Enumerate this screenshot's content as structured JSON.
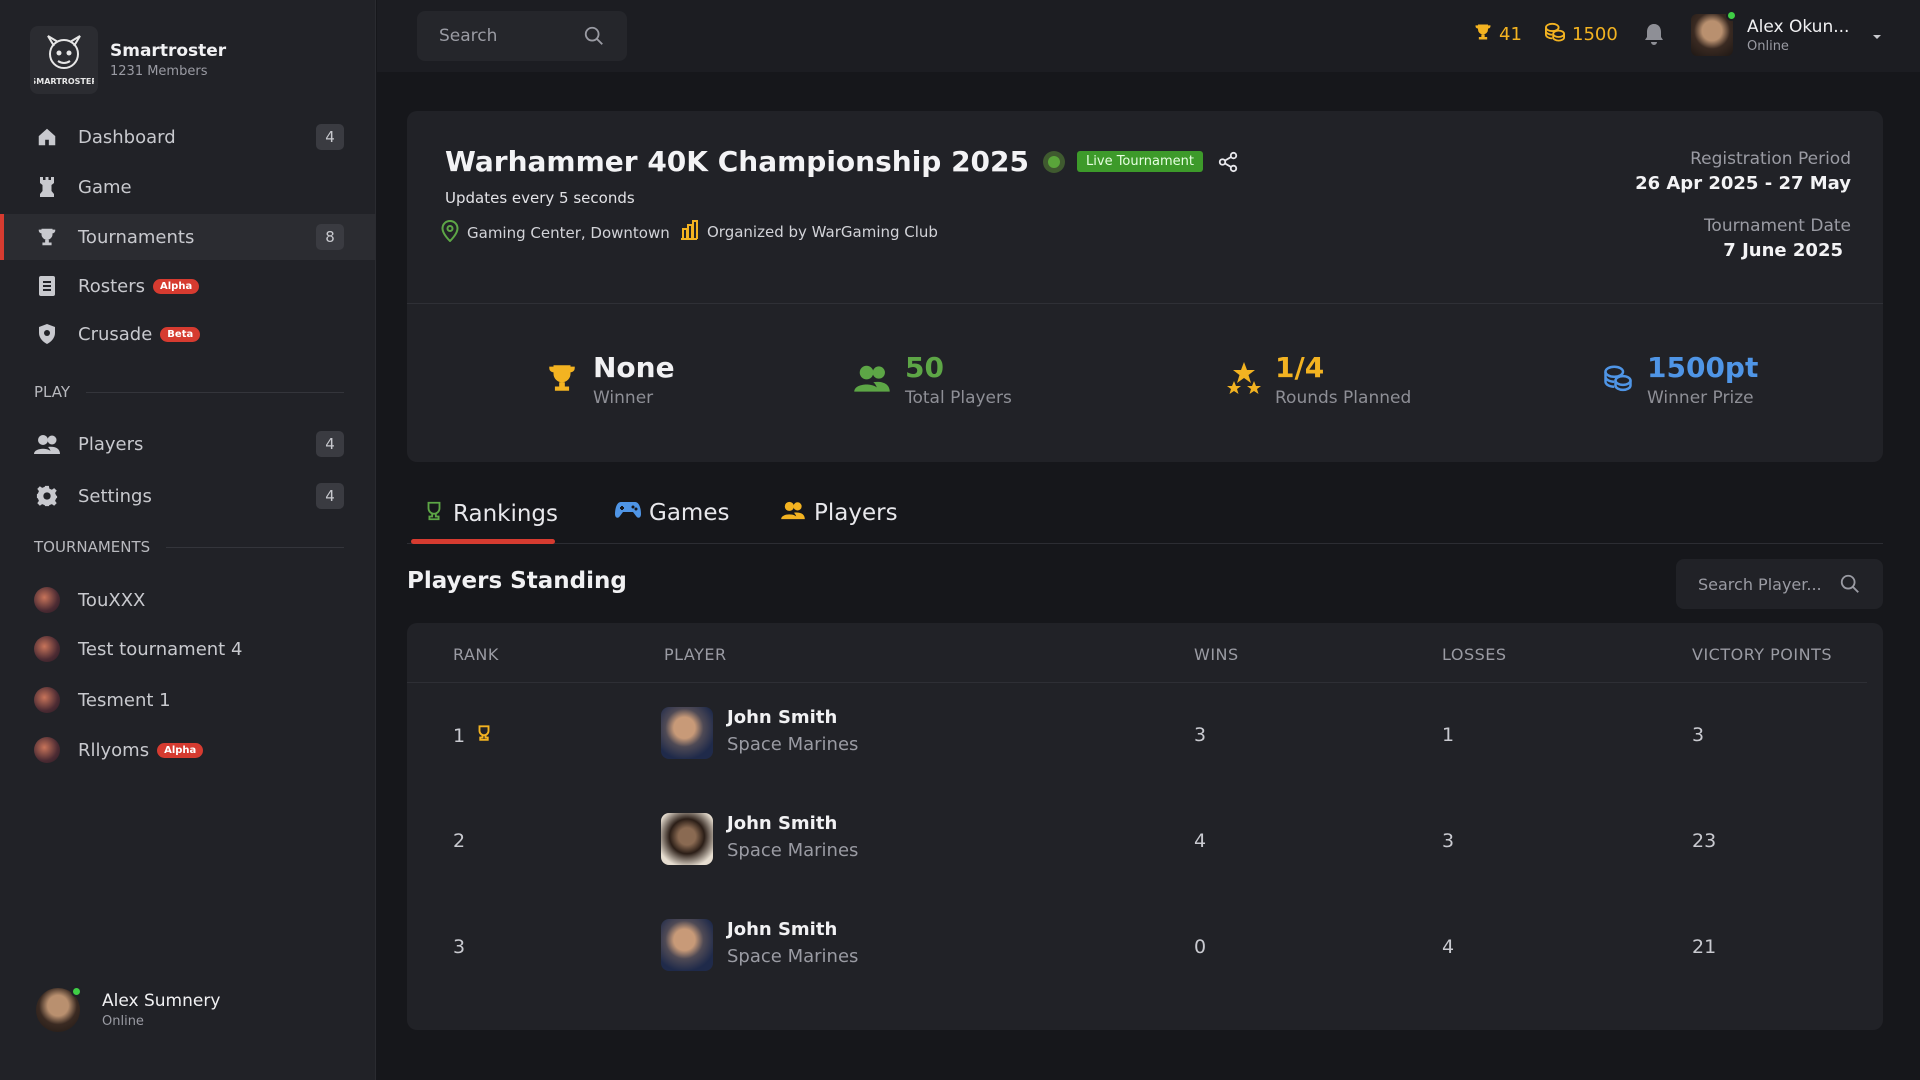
{
  "brand": {
    "name": "Smartroster",
    "members": "1231 Members",
    "logo_text": "SMARTROSTER"
  },
  "nav": {
    "items": [
      {
        "label": "Dashboard",
        "count": "4",
        "icon": "home-icon"
      },
      {
        "label": "Game",
        "icon": "chess-rook-icon"
      },
      {
        "label": "Tournaments",
        "count": "8",
        "icon": "trophy-icon"
      },
      {
        "label": "Rosters",
        "badge": "Alpha",
        "icon": "list-icon"
      },
      {
        "label": "Crusade",
        "badge": "Beta",
        "icon": "shield-icon"
      }
    ],
    "play_section": "PLAY",
    "play_items": [
      {
        "label": "Players",
        "count": "4",
        "icon": "users-icon"
      },
      {
        "label": "Settings",
        "count": "4",
        "icon": "gear-icon"
      }
    ],
    "tournaments_section": "TOURNAMENTS",
    "tournaments": [
      {
        "label": "TouXXX"
      },
      {
        "label": "Test tournament 4"
      },
      {
        "label": "Tesment 1"
      },
      {
        "label": "Rllyoms",
        "badge": "Alpha"
      }
    ]
  },
  "sidebar_user": {
    "name": "Alex Sumnery",
    "status": "Online"
  },
  "topbar": {
    "search_placeholder": "Search",
    "trophies": "41",
    "coins": "1500",
    "user_name": "Alex Okun...",
    "user_status": "Online"
  },
  "tournament": {
    "title": "Warhammer 40K Championship 2025",
    "live_label": "Live Tournament",
    "updates": "Updates every 5 seconds",
    "location": "Gaming Center, Downtown",
    "organizer": "Organized by WarGaming Club",
    "registration_label": "Registration Period",
    "registration_value": "26 Apr 2025 - 27 May",
    "date_label": "Tournament Date",
    "date_value": "7 June 2025",
    "stats": [
      {
        "value": "None",
        "label": "Winner",
        "color": "#f1f1f3"
      },
      {
        "value": "50",
        "label": "Total Players",
        "color": "#5da646"
      },
      {
        "value": "1/4",
        "label": "Rounds Planned",
        "color": "#f3b321"
      },
      {
        "value": "1500pt",
        "label": "Winner Prize",
        "color": "#4f95e6"
      }
    ]
  },
  "tabs": [
    {
      "label": "Rankings",
      "icon": "trophy-icon"
    },
    {
      "label": "Games",
      "icon": "gamepad-icon"
    },
    {
      "label": "Players",
      "icon": "users-icon"
    }
  ],
  "standings": {
    "title": "Players Standing",
    "search_placeholder": "Search Player...",
    "columns": [
      "RANK",
      "PLAYER",
      "WINS",
      "LOSSES",
      "VICTORY POINTS"
    ],
    "rows": [
      {
        "rank": "1",
        "name": "John Smith",
        "faction": "Space Marines",
        "wins": "3",
        "losses": "1",
        "vp": "3"
      },
      {
        "rank": "2",
        "name": "John Smith",
        "faction": "Space Marines",
        "wins": "4",
        "losses": "3",
        "vp": "23"
      },
      {
        "rank": "3",
        "name": "John Smith",
        "faction": "Space Marines",
        "wins": "0",
        "losses": "4",
        "vp": "21"
      }
    ]
  },
  "colors": {
    "accent": "#d63b30",
    "gold": "#f3b321",
    "green": "#5da646",
    "blue": "#4f95e6",
    "live": "#3d9a2a"
  }
}
